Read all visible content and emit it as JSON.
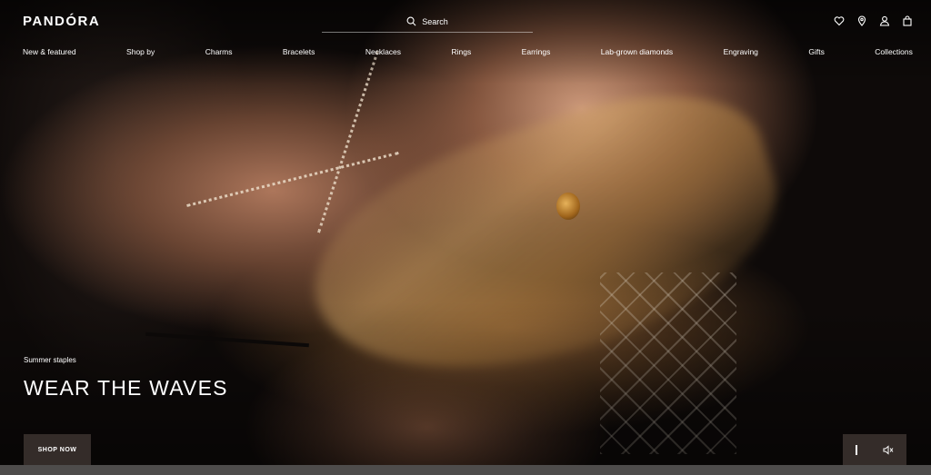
{
  "header": {
    "logo": "PANDÓRA",
    "search_label": "Search"
  },
  "nav": {
    "items": [
      "New & featured",
      "Shop by",
      "Charms",
      "Bracelets",
      "Necklaces",
      "Rings",
      "Earrings",
      "Lab-grown diamonds",
      "Engraving",
      "Gifts",
      "Collections"
    ]
  },
  "hero": {
    "eyebrow": "Summer staples",
    "headline": "WEAR THE WAVES",
    "cta_label": "SHOP NOW"
  },
  "icons": [
    "search-icon",
    "heart-icon",
    "location-pin-icon",
    "user-icon",
    "shopping-bag-icon",
    "pause-icon",
    "mute-icon"
  ]
}
